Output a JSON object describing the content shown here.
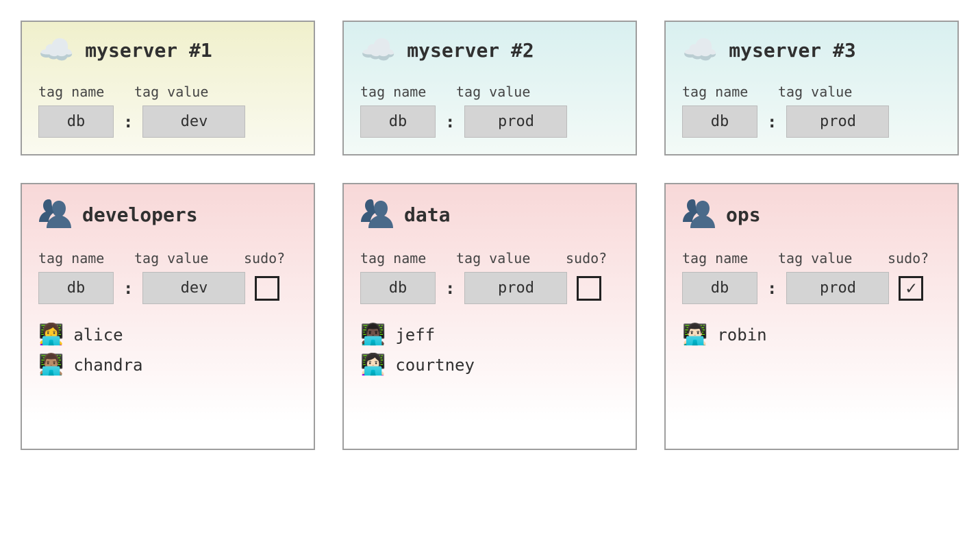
{
  "labels": {
    "tag_name": "tag name",
    "tag_value": "tag value",
    "sudo": "sudo?",
    "colon": ":",
    "check": "✓"
  },
  "servers": [
    {
      "title": "myserver #1",
      "tint": "yellow",
      "tag_name": "db",
      "tag_value": "dev"
    },
    {
      "title": "myserver #2",
      "tint": "blue",
      "tag_name": "db",
      "tag_value": "prod"
    },
    {
      "title": "myserver #3",
      "tint": "blue",
      "tag_name": "db",
      "tag_value": "prod"
    }
  ],
  "groups": [
    {
      "title": "developers",
      "tag_name": "db",
      "tag_value": "dev",
      "sudo": false,
      "members": [
        {
          "emoji": "👩‍💻",
          "name": "alice"
        },
        {
          "emoji": "👨🏽‍💻",
          "name": "chandra"
        }
      ]
    },
    {
      "title": "data",
      "tag_name": "db",
      "tag_value": "prod",
      "sudo": false,
      "members": [
        {
          "emoji": "👨🏿‍💻",
          "name": "jeff"
        },
        {
          "emoji": "👩🏻‍💻",
          "name": "courtney"
        }
      ]
    },
    {
      "title": "ops",
      "tag_name": "db",
      "tag_value": "prod",
      "sudo": true,
      "members": [
        {
          "emoji": "👨🏻‍💻",
          "name": "robin"
        }
      ]
    }
  ]
}
